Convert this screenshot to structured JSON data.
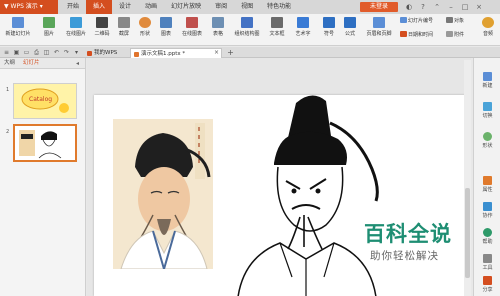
{
  "app": {
    "name": "WPS 演示"
  },
  "menu": [
    {
      "label": "开始"
    },
    {
      "label": "插入"
    },
    {
      "label": "设计"
    },
    {
      "label": "动画"
    },
    {
      "label": "幻灯片放映"
    },
    {
      "label": "审阅"
    },
    {
      "label": "视图"
    },
    {
      "label": "特色功能"
    }
  ],
  "login": {
    "label": "未登录"
  },
  "ribbon": {
    "new_slide": "新建幻灯片",
    "picture": "图片",
    "online_picture": "在线图片",
    "qrcode": "二维码",
    "screenshot": "截屏",
    "shape": "形状",
    "chart": "图表",
    "online_chart": "在线图表",
    "table": "表格",
    "org_chart": "组织结构图",
    "textbox": "文本框",
    "wordart": "艺术字",
    "symbol": "符号",
    "formula": "公式",
    "header_footer": "页眉和页脚",
    "slide_number": "幻灯片编号",
    "date_time": "日期和时间",
    "object": "对象",
    "attachment": "附件",
    "audio": "音频"
  },
  "doc_tabs": {
    "home": "我的WPS",
    "current": "演示文稿1.pptx *",
    "add": "+"
  },
  "left_panel": {
    "tab_outline": "大纲",
    "tab_slides": "幻灯片",
    "thumb1_num": "1",
    "thumb2_num": "2",
    "thumb1_text": "Catalog"
  },
  "right_sidebar": [
    {
      "label": "新建"
    },
    {
      "label": "切换"
    },
    {
      "label": "形状"
    },
    {
      "label": "属性"
    },
    {
      "label": "协作"
    },
    {
      "label": "帮助"
    },
    {
      "label": "工具"
    },
    {
      "label": "分享"
    }
  ],
  "watermark": {
    "line1": "百科全说",
    "line2": "助你轻松解决"
  },
  "colors": {
    "accent": "#d44e1f",
    "watermark": "#1e8e73"
  }
}
